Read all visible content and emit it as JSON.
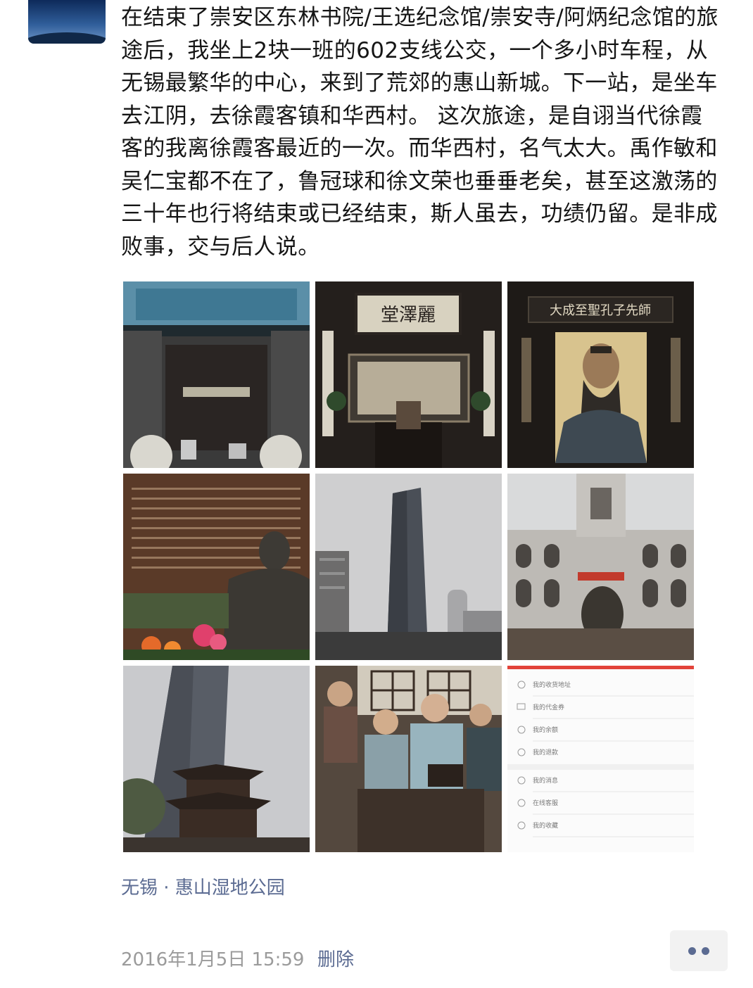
{
  "post": {
    "text": "在结束了崇安区东林书院/王选纪念馆/崇安寺/阿炳纪念馆的旅途后，我坐上2块一班的602支线公交，一个多小时车程，从无锡最繁华的中心，来到了荒郊的惠山新城。下一站，是坐车去江阴，去徐霞客镇和华西村。 这次旅途，是自诩当代徐霞客的我离徐霞客最近的一次。而华西村，名气太大。禹作敏和吴仁宝都不在了，鲁冠球和徐文荣也垂垂老矣，甚至这激荡的三十年也行将结束或已经结束，斯人虽去，功绩仍留。是非成败事，交与后人说。",
    "location": "无锡 · 惠山湿地公园",
    "timestamp": "2016年1月5日 15:59",
    "delete_label": "删除"
  },
  "photos": [
    {
      "name": "photo-academy-gate"
    },
    {
      "name": "photo-hall-plaque"
    },
    {
      "name": "photo-confucius-portrait"
    },
    {
      "name": "photo-bronze-statue"
    },
    {
      "name": "photo-skyscraper"
    },
    {
      "name": "photo-memorial-building"
    },
    {
      "name": "photo-tower-pavilion"
    },
    {
      "name": "photo-wax-figures"
    },
    {
      "name": "photo-app-screenshot"
    }
  ],
  "plaques": {
    "hall": "堂澤麗",
    "confucius": "大成至聖孔子先師"
  },
  "screenshot_menu": [
    "我的收货地址",
    "我的代金券",
    "我的余额",
    "我的退款",
    "我的消息",
    "在线客服",
    "我的收藏"
  ],
  "icons": {
    "more": "more-dots-icon"
  },
  "colors": {
    "link": "#5b6b92",
    "timestamp": "#9b9b9b",
    "more_button_bg": "#f2f2f2"
  }
}
